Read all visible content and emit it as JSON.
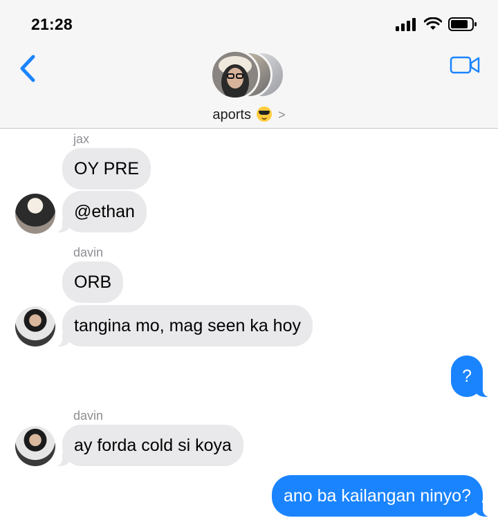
{
  "status_bar": {
    "time": "21:28"
  },
  "header": {
    "group_name": "aports",
    "group_emoji": "smiling-face-with-sunglasses",
    "chevron": ">"
  },
  "colors": {
    "accent": "#1a84ff",
    "incoming_bubble": "#e9e9eb",
    "header_bg": "#f6f6f6",
    "sender_label": "#8e8e93"
  },
  "messages": [
    {
      "sender": "jax",
      "direction": "incoming",
      "text": "OY PRE"
    },
    {
      "sender": "",
      "direction": "incoming",
      "text": "@ethan"
    },
    {
      "sender": "davin",
      "direction": "incoming",
      "text": "ORB"
    },
    {
      "sender": "",
      "direction": "incoming",
      "text": "tangina mo, mag seen ka hoy"
    },
    {
      "sender": "",
      "direction": "outgoing",
      "text": "?"
    },
    {
      "sender": "davin",
      "direction": "incoming",
      "text": "ay forda cold si koya"
    },
    {
      "sender": "",
      "direction": "outgoing",
      "text": "ano ba kailangan ninyo?"
    }
  ]
}
